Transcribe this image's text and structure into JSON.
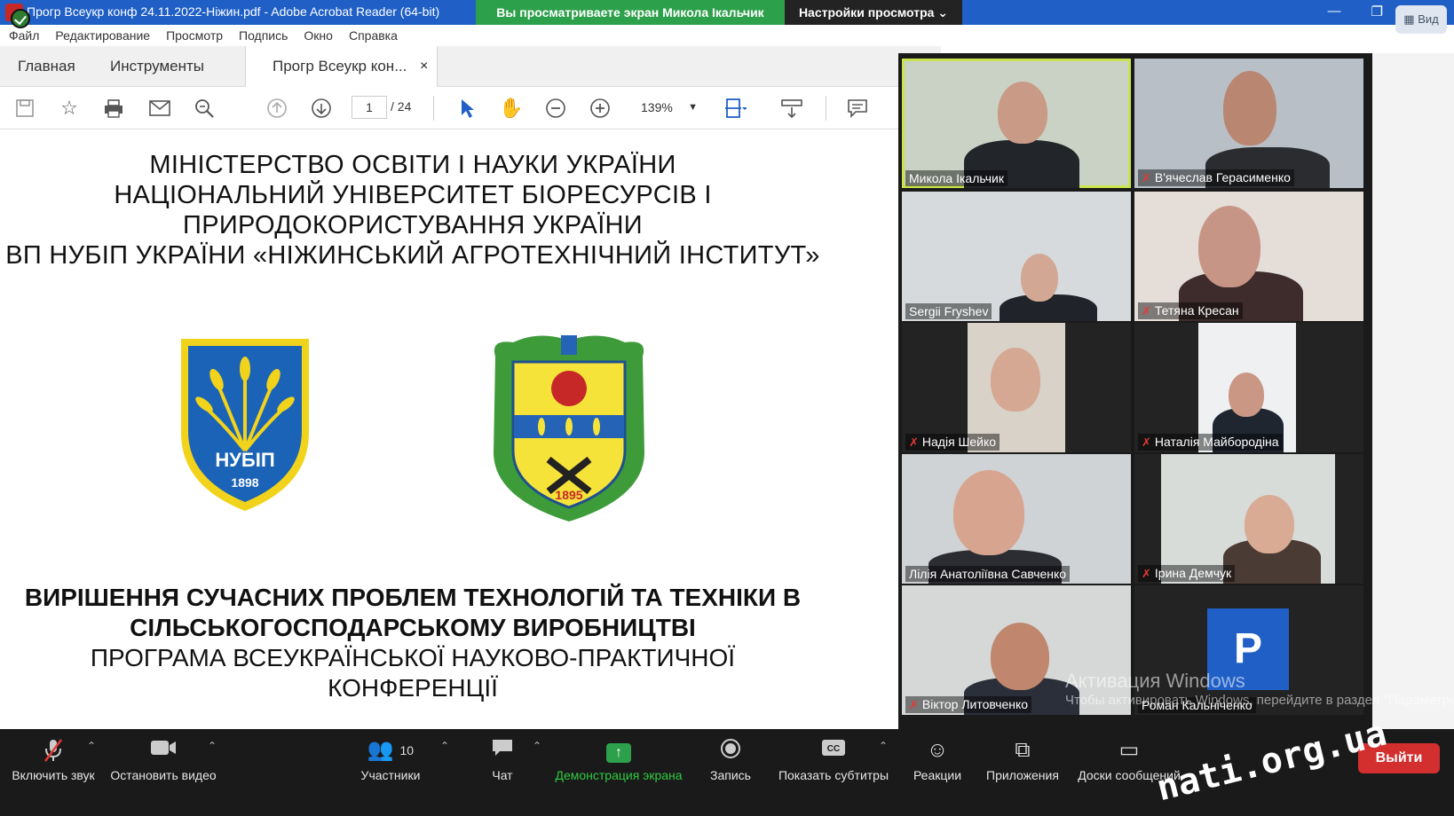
{
  "window": {
    "title": "Прогр Всеукр конф 24.11.2022-Ніжин.pdf - Adobe Acrobat Reader (64-bit)",
    "share_banner": "Вы просматриваете экран Микола Ікальчик",
    "view_settings": "Настройки просмотра ⌄",
    "view_button": "Вид",
    "controls": [
      "—",
      "❐",
      "✕"
    ]
  },
  "menu": [
    "Файл",
    "Редактирование",
    "Просмотр",
    "Подпись",
    "Окно",
    "Справка"
  ],
  "tabs": {
    "home": "Главная",
    "tools": "Инструменты",
    "document": "Прогр Всеукр кон...",
    "close": "×"
  },
  "toolbar": {
    "page_current": "1",
    "page_total": "/ 24",
    "zoom": "139%"
  },
  "document": {
    "header_lines": [
      "МІНІСТЕРСТВО ОСВІТИ І НАУКИ УКРАЇНИ",
      "НАЦІОНАЛЬНИЙ УНІВЕРСИТЕТ БІОРЕСУРСІВ І",
      "ПРИРОДОКОРИСТУВАННЯ УКРАЇНИ",
      "ВП НУБІП УКРАЇНИ «НІЖИНСЬКИЙ АГРОТЕХНІЧНИЙ ІНСТИТУТ»"
    ],
    "logo_left": {
      "text": "НУБІП",
      "year": "1898"
    },
    "logo_right": {
      "year": "1895"
    },
    "title_lines": [
      "ВИРІШЕННЯ СУЧАСНИХ ПРОБЛЕМ ТЕХНОЛОГІЙ ТА ТЕХНІКИ В",
      "СІЛЬСЬКОГОСПОДАРСЬКОМУ ВИРОБНИЦТВІ"
    ],
    "subtitle_lines": [
      "ПРОГРАМА ВСЕУКРАЇНСЬКОЇ НАУКОВО-ПРАКТИЧНОЇ",
      "КОНФЕРЕНЦІЇ"
    ]
  },
  "participants": [
    {
      "name": "Микола Ікальчик",
      "muted": false
    },
    {
      "name": "В'ячеслав Герасименко",
      "muted": true
    },
    {
      "name": "Sergii Fryshev",
      "muted": false
    },
    {
      "name": "Тетяна Кресан",
      "muted": true
    },
    {
      "name": "Надія Шейко",
      "muted": true
    },
    {
      "name": "Наталія Майбородіна",
      "muted": true
    },
    {
      "name": "Лілія Анатоліївна Савченко",
      "muted": false
    },
    {
      "name": "Ірина Демчук",
      "muted": true
    },
    {
      "name": "Віктор Литовченко",
      "muted": true
    },
    {
      "name": "Роман Кальніченко",
      "muted": false,
      "avatar_letter": "P"
    }
  ],
  "windows_activation": {
    "title": "Активация Windows",
    "hint": "Чтобы активировать Windows, перейдите в раздел \"Параметры\"."
  },
  "bottom_bar": {
    "unmute": "Включить звук",
    "stop_video": "Остановить видео",
    "participants": "Участники",
    "participants_count": "10",
    "chat": "Чат",
    "share_screen": "Демонстрация экрана",
    "record": "Запись",
    "captions": "Показать субтитры",
    "reactions": "Реакции",
    "apps": "Приложения",
    "whiteboards": "Доски сообщений",
    "leave": "Выйти"
  },
  "watermark": "nati.org.ua",
  "colors": {
    "titlebar": "#1f5fc6",
    "share_green": "#2da04b",
    "leave_red": "#d32f2f",
    "speaker_outline": "#cbe34f"
  }
}
